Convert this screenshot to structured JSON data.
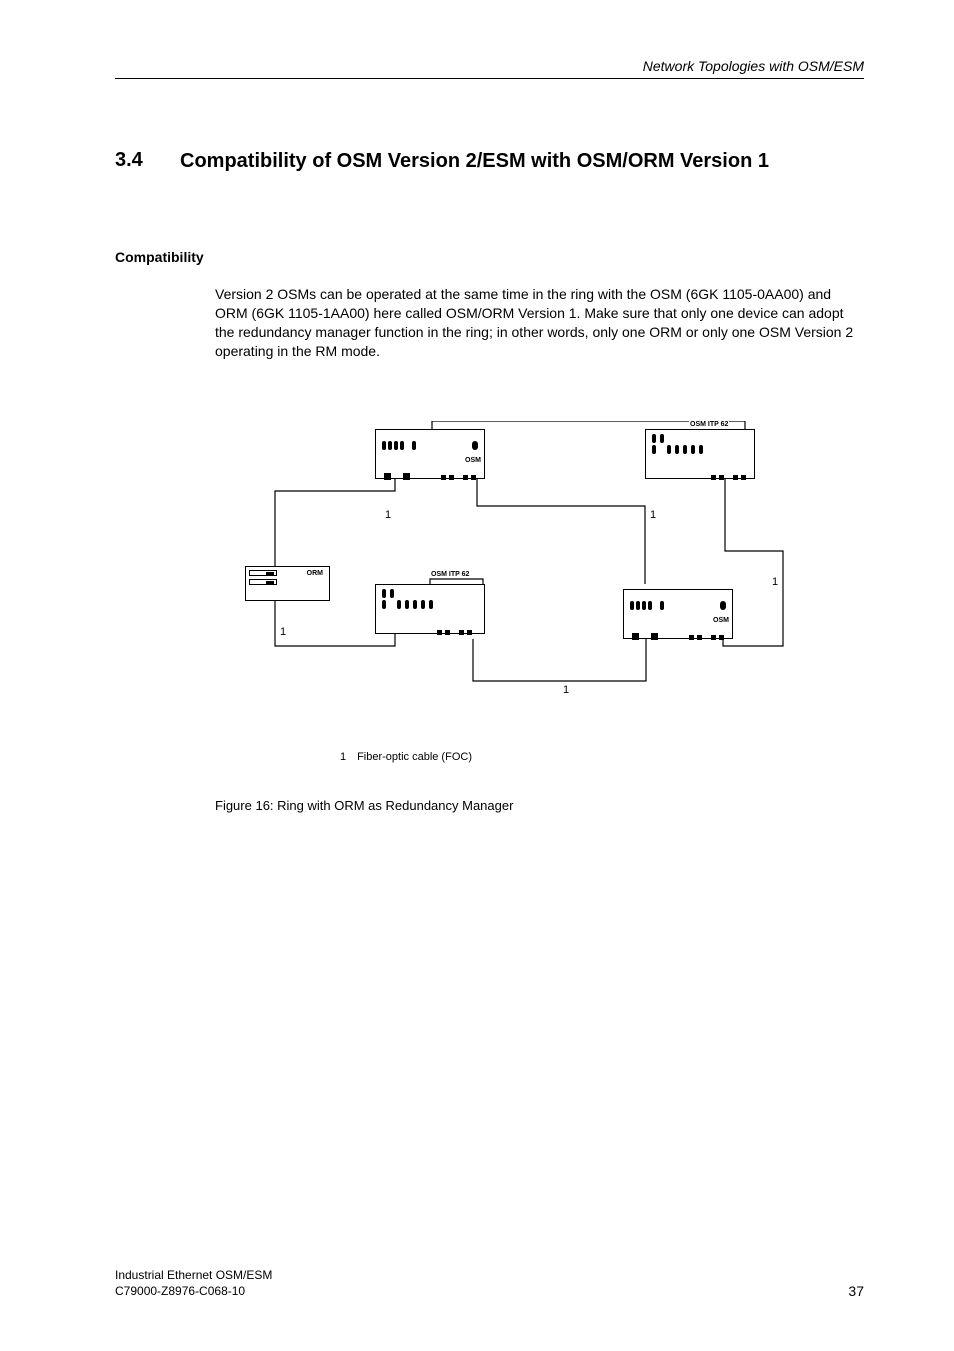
{
  "header": {
    "running_title": "Network Topologies with OSM/ESM"
  },
  "section": {
    "number": "3.4",
    "title": "Compatibility of OSM Version 2/ESM with OSM/ORM Version 1"
  },
  "subhead": "Compatibility",
  "body": "Version 2 OSMs can be operated at the same time in the ring with the OSM (6GK 1105-0AA00) and ORM (6GK 1105-1AA00) here called OSM/ORM Version 1. Make sure that only one device can adopt the redundancy manager function in the ring; in other words, only one ORM or only one OSM Version 2 operating in the RM mode.",
  "diagram": {
    "device_labels": {
      "osm": "OSM",
      "osm_itp_62": "OSM ITP 62",
      "orm": "ORM"
    },
    "cable_num": "1",
    "legend_num": "1",
    "legend_text": "Fiber-optic cable (FOC)"
  },
  "caption": "Figure 16: Ring with ORM as Redundancy Manager",
  "footer": {
    "line1": "Industrial Ethernet OSM/ESM",
    "line2": "C79000-Z8976-C068-10",
    "page": "37"
  }
}
